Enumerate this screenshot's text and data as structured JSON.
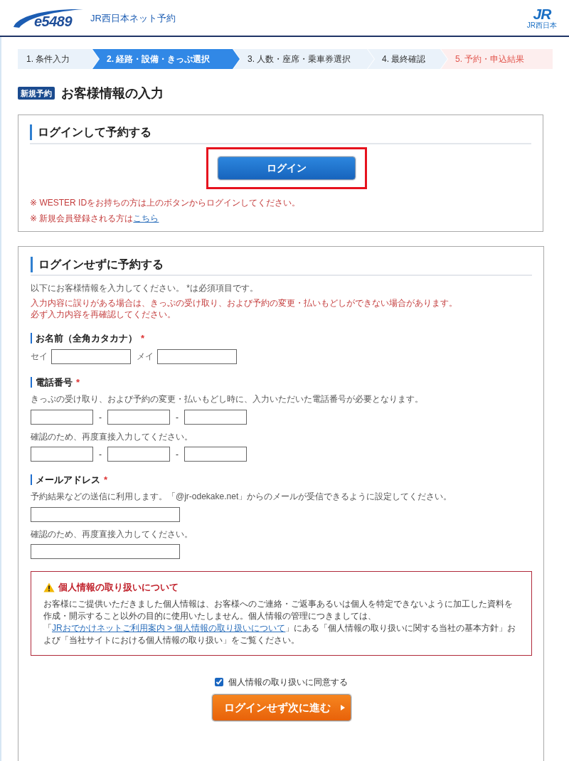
{
  "header": {
    "logo_text": "e5489",
    "title": "JR西日本ネット予約",
    "brand_mark": "JR",
    "brand_caption": "JR西日本"
  },
  "steps": [
    {
      "label": "1. 条件入力",
      "selected": false,
      "kind": "step"
    },
    {
      "label": "2. 経路・設備・きっぷ選択",
      "selected": true,
      "kind": "step"
    },
    {
      "label": "3. 人数・座席・乗車券選択",
      "selected": false,
      "kind": "step"
    },
    {
      "label": "4. 最終確認",
      "selected": false,
      "kind": "step"
    },
    {
      "label": "5. 予約・申込結果",
      "selected": false,
      "kind": "result"
    }
  ],
  "page_title": {
    "tag": "新規予約",
    "title": "お客様情報の入力"
  },
  "login_section": {
    "heading": "ログインして予約する",
    "button": "ログイン",
    "highlighted": true,
    "notes": [
      {
        "text": "※ WESTER IDをお持ちの方は上のボタンからログインしてください。"
      },
      {
        "text": "※ 新規会員登録される方は",
        "link": "こちら"
      }
    ]
  },
  "guest_section": {
    "heading": "ログインせずに予約する",
    "intro": "以下にお客様情報を入力してください。 *は必須項目です。",
    "warnings": [
      "入力内容に誤りがある場合は、きっぷの受け取り、および予約の変更・払いもどしができない場合があります。",
      "必ず入力内容を再確認してください。"
    ],
    "fields": [
      {
        "kind": "name",
        "label": "お名前（全角カタカナ）",
        "required_mark": "*",
        "inputs": [
          {
            "prefix": "セイ"
          },
          {
            "prefix": "メイ"
          }
        ]
      },
      {
        "kind": "phone",
        "label": "電話番号",
        "required_mark": "*",
        "hint": "きっぷの受け取り、および予約の変更・払いもどし時に、入力いただいた電話番号が必要となります。",
        "separators": [
          "-",
          "-"
        ],
        "confirm_label": "確認のため、再度直接入力してください。",
        "confirm_separators": [
          "-",
          "-"
        ]
      },
      {
        "kind": "email",
        "label": "メールアドレス",
        "required_mark": "*",
        "hint": "予約結果などの送信に利用します。「@jr-odekake.net」からのメールが受信できるように設定してください。",
        "confirm_label": "確認のため、再度直接入力してください。"
      }
    ]
  },
  "privacy": {
    "title": "個人情報の取り扱いについて",
    "text_before": "お客様にご提供いただきました個人情報は、お客様へのご連絡・ご返事あるいは個人を特定できないように加工した資料を作成・開示すること以外の目的に使用いたしません。個人情報の管理につきましては、「",
    "link": "JRおでかけネットご利用案内 > 個人情報の取り扱いについて",
    "text_after": "」にある「個人情報の取り扱いに関する当社の基本方針」および「当社サイトにおける個人情報の取り扱い」をご覧ください。"
  },
  "consent": {
    "label": "個人情報の取り扱いに同意する",
    "checked": true
  },
  "next_button": {
    "label": "ログインせず次に進む"
  }
}
